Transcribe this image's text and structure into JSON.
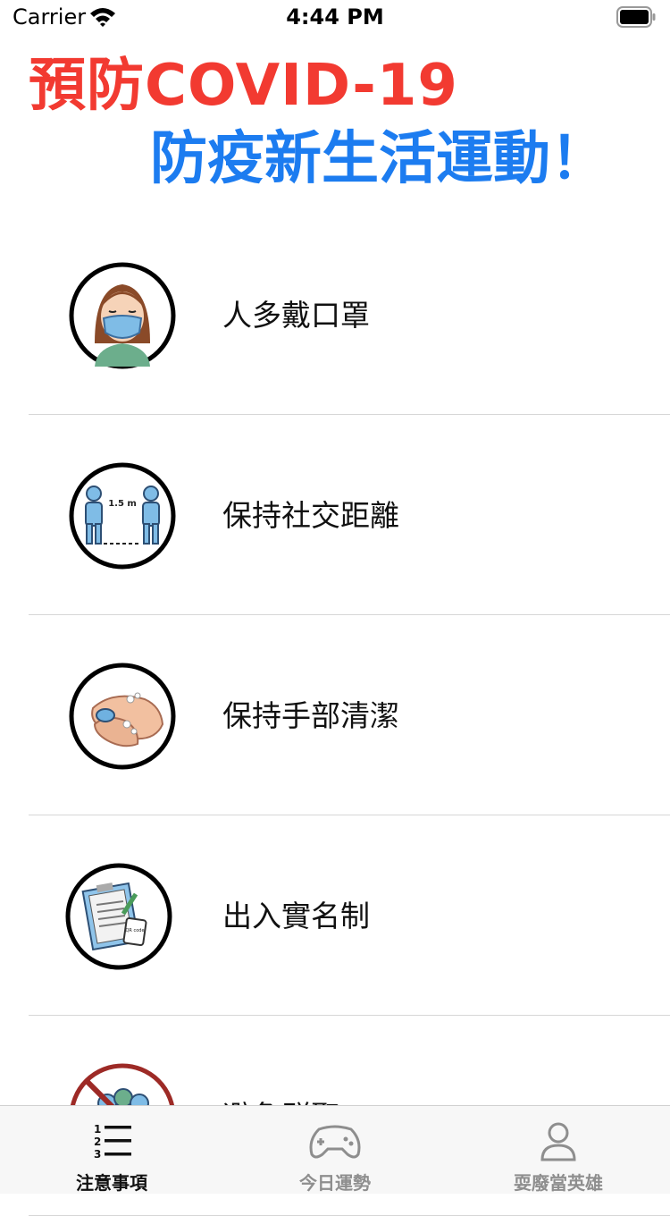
{
  "status_bar": {
    "carrier": "Carrier",
    "time": "4:44 PM"
  },
  "header": {
    "title_line1": "預防COVID-19",
    "title_line2": "防疫新生活運動！"
  },
  "colors": {
    "title_red": "#f23a31",
    "title_blue": "#1c7cf0",
    "separator": "#d6d6d6",
    "tab_active": "#111111",
    "tab_inactive": "#8e8e8e"
  },
  "list": {
    "items": [
      {
        "label": "人多戴口罩",
        "icon": "face-mask-icon"
      },
      {
        "label": "保持社交距離",
        "icon": "social-distance-icon",
        "distance_text": "1.5 m"
      },
      {
        "label": "保持手部清潔",
        "icon": "hand-washing-icon"
      },
      {
        "label": "出入實名制",
        "icon": "clipboard-registration-icon",
        "qr_text": "QR code"
      },
      {
        "label": "避免群聚",
        "icon": "no-gathering-icon"
      }
    ]
  },
  "tabbar": {
    "tabs": [
      {
        "label": "注意事項",
        "icon": "numbered-list-icon",
        "active": true
      },
      {
        "label": "今日運勢",
        "icon": "gamepad-icon",
        "active": false
      },
      {
        "label": "耍廢當英雄",
        "icon": "person-icon",
        "active": false
      }
    ]
  }
}
